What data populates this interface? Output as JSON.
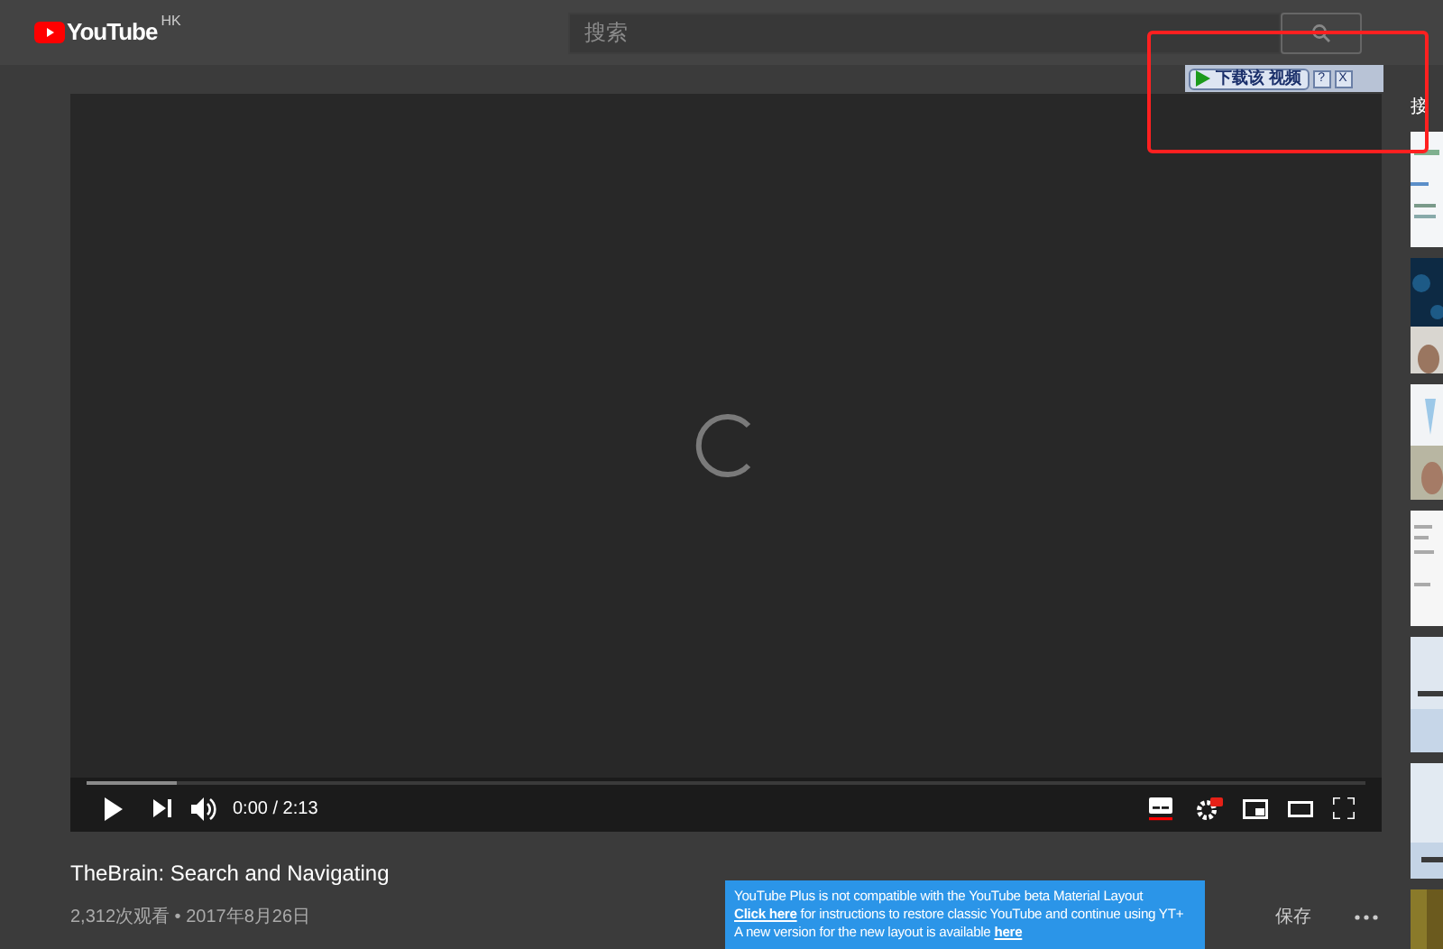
{
  "header": {
    "logo": "YouTube",
    "region": "HK",
    "search": {
      "placeholder": "搜索"
    }
  },
  "player": {
    "buffer": {
      "level": 0.07
    },
    "time": "0:00 / 2:13"
  },
  "download_bar": {
    "label": "下载该 视频",
    "help": "?",
    "close": "X"
  },
  "video": {
    "title": "TheBrain: Search and Navigating",
    "meta": "2,312次观看 • 2017年8月26日",
    "save": "保存"
  },
  "up_next": {
    "heading": "接"
  },
  "notice": {
    "line_1": "YouTube Plus is not compatible with the YouTube beta Material Layout",
    "link_1": "Click here",
    "line_2": " for instructions to restore classic YouTube and continue using YT+",
    "line_3": "A new version for the new layout is available ",
    "link_2": "here"
  }
}
